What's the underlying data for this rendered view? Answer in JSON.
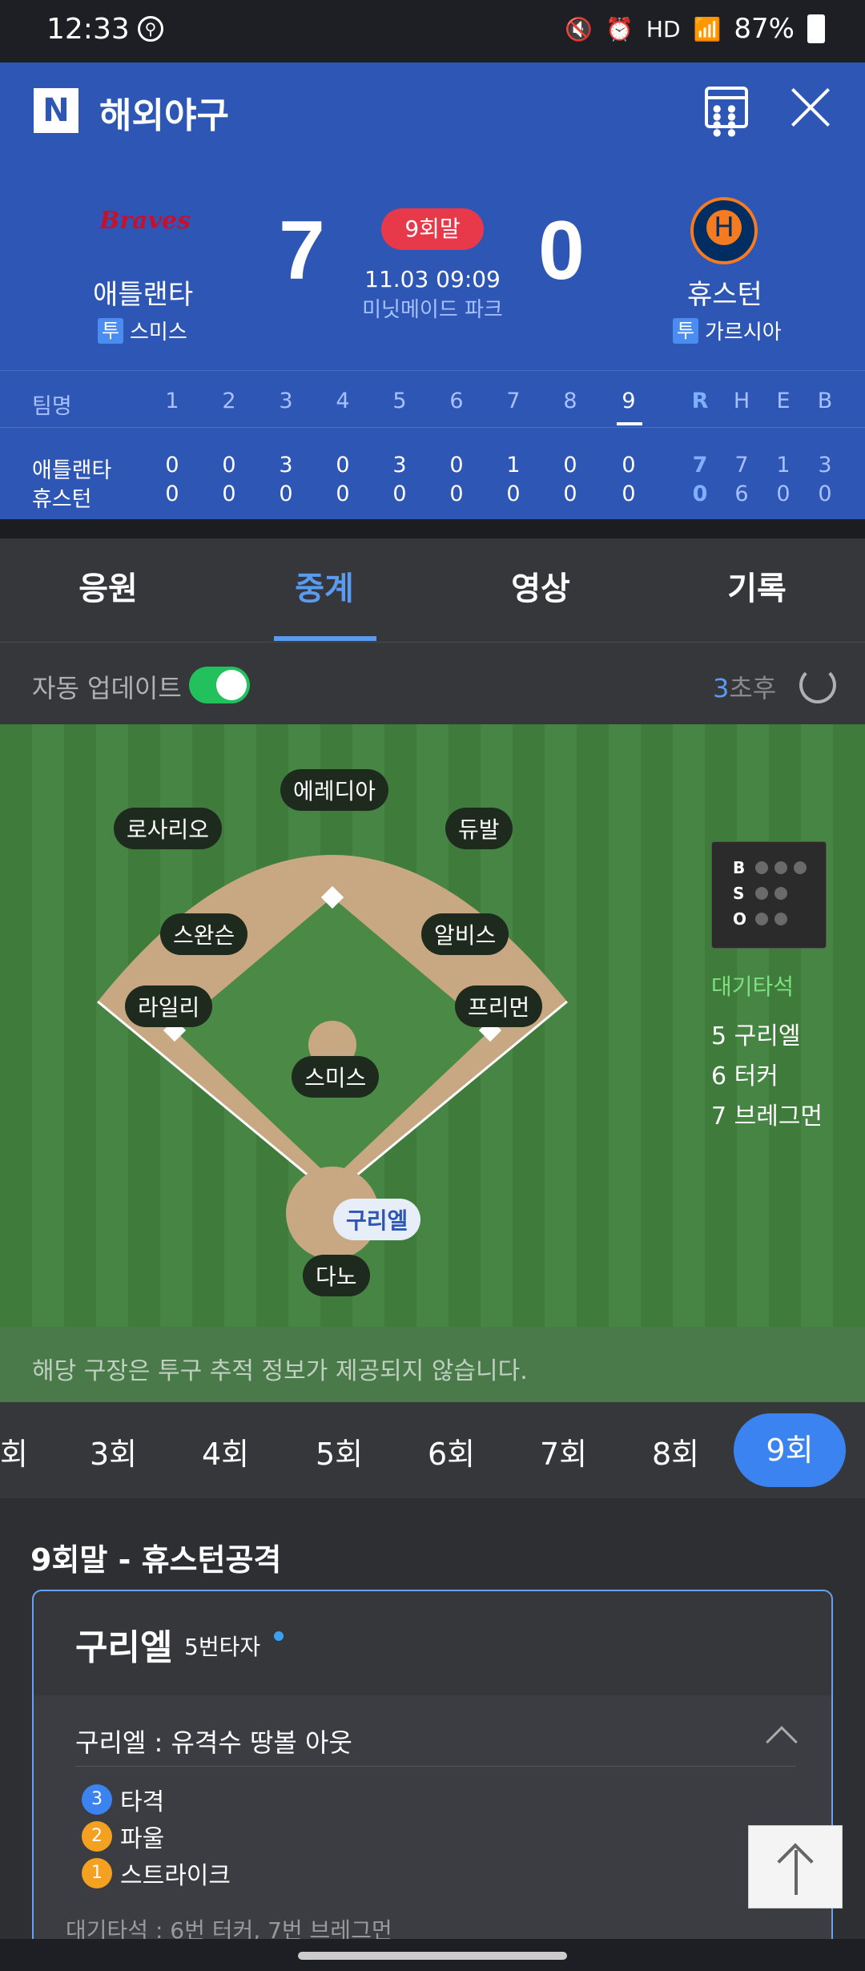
{
  "status": {
    "time": "12:33",
    "battery": "87%",
    "hd": "HD"
  },
  "header": {
    "logo": "N",
    "title": "해외야구",
    "home": {
      "name": "애틀랜타",
      "pitcher_tag": "투",
      "pitcher": "스미스",
      "score": "7",
      "logo_text": "Braves"
    },
    "away": {
      "name": "휴스턴",
      "pitcher_tag": "투",
      "pitcher": "가르시아",
      "score": "0",
      "logo_text": "H"
    },
    "inning": "9회말",
    "datetime": "11.03 09:09",
    "stadium": "미닛메이드 파크"
  },
  "linescore": {
    "label": "팀명",
    "innings": [
      "1",
      "2",
      "3",
      "4",
      "5",
      "6",
      "7",
      "8",
      "9"
    ],
    "stats": [
      "R",
      "H",
      "E",
      "B"
    ],
    "teams": [
      {
        "name": "애틀랜타",
        "runs": [
          "0",
          "0",
          "3",
          "0",
          "3",
          "0",
          "1",
          "0",
          "0"
        ],
        "R": "7",
        "H": "7",
        "E": "1",
        "B": "3"
      },
      {
        "name": "휴스턴",
        "runs": [
          "0",
          "0",
          "0",
          "0",
          "0",
          "0",
          "0",
          "0",
          "0"
        ],
        "R": "0",
        "H": "6",
        "E": "0",
        "B": "0"
      }
    ]
  },
  "tabs": [
    "응원",
    "중계",
    "영상",
    "기록"
  ],
  "auto": {
    "label": "자동 업데이트",
    "countdown_num": "3",
    "countdown_unit": "초후"
  },
  "field": {
    "players": {
      "cf": "에레디아",
      "lf": "로사리오",
      "rf": "듀발",
      "ss": "스완슨",
      "2b": "알비스",
      "3b": "라일리",
      "1b": "프리먼",
      "p": "스미스",
      "batter": "구리엘",
      "c": "다노"
    },
    "bso": [
      "B",
      "S",
      "O"
    ],
    "ondeck_label": "대기타석",
    "ondeck": [
      "5 구리엘",
      "6 터커",
      "7 브레그먼"
    ]
  },
  "notice": "해당 구장은 투구 추적 정보가 제공되지 않습니다.",
  "innings_bar": [
    "회",
    "3회",
    "4회",
    "5회",
    "6회",
    "7회",
    "8회",
    "9회"
  ],
  "play": {
    "section_title": "9회말 - 휴스턴공격",
    "batter": "구리엘",
    "order": "5번타자",
    "result": "구리엘 : 유격수 땅볼 아웃",
    "pitches": [
      {
        "n": "3",
        "label": "타격"
      },
      {
        "n": "2",
        "label": "파울"
      },
      {
        "n": "1",
        "label": "스트라이크"
      }
    ],
    "footer": "대기타석 : 6번 터커, 7번 브레그먼"
  }
}
